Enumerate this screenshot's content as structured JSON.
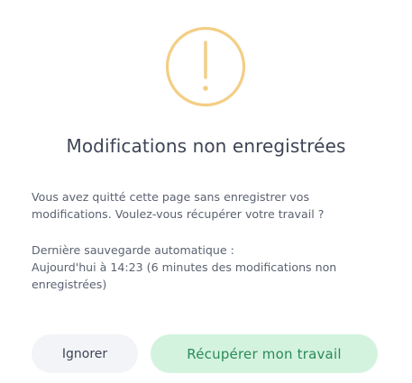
{
  "dialog": {
    "icon": "exclamation-circle-icon",
    "icon_color": "#f3ce84",
    "title": "Modifications non enregistrées",
    "message": "Vous avez quitté cette page sans enregistrer vos modifications. Voulez-vous récupérer votre travail ?",
    "autosave_label": "Dernière sauvegarde automatique :",
    "autosave_detail": "Aujourd'hui à 14:23 (6 minutes des modifications non enregistrées)",
    "ignore_label": "Ignorer",
    "recover_label": "Récupérer mon travail",
    "recover_color": "#2b8a58",
    "recover_bg": "#d3f3df"
  }
}
